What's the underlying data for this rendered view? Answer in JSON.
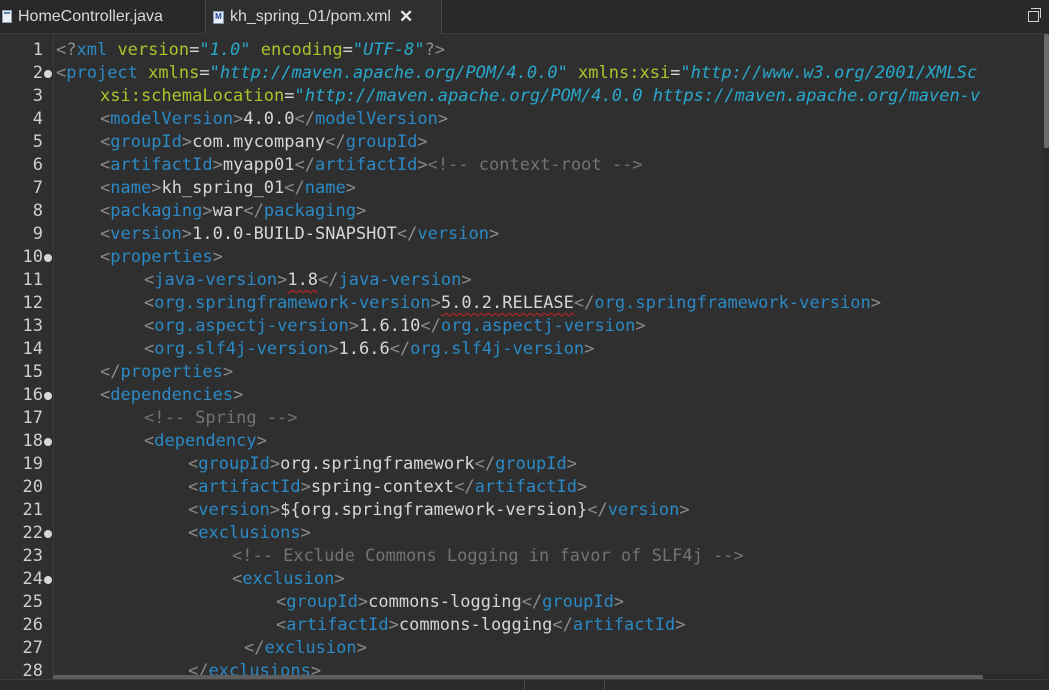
{
  "tabs": [
    {
      "label": "HomeController.java",
      "icon": "java-file-icon",
      "active": false
    },
    {
      "label": "kh_spring_01/pom.xml",
      "icon": "maven-pom-icon",
      "active": true,
      "close": "✕"
    }
  ],
  "editor": {
    "line_numbers": [
      "1",
      "2",
      "3",
      "4",
      "5",
      "6",
      "7",
      "8",
      "9",
      "10",
      "11",
      "12",
      "13",
      "14",
      "15",
      "16",
      "17",
      "18",
      "19",
      "20",
      "21",
      "22",
      "23",
      "24",
      "25",
      "26",
      "27",
      "28"
    ],
    "folded_lines": [
      "2",
      "10",
      "16",
      "18",
      "22",
      "24"
    ],
    "lines": {
      "l1": {
        "pi_open": "<?",
        "tag": "xml",
        "a1": " version",
        "eq1": "=",
        "v1": "\"1.0\"",
        "a2": " encoding",
        "eq2": "=",
        "v2": "\"UTF-8\"",
        "pi_close": "?>"
      },
      "l2": {
        "open": "<",
        "tag": "project",
        "a1": " xmlns",
        "eq1": "=",
        "v1": "\"http://maven.apache.org/POM/4.0.0\"",
        "a2": " xmlns:xsi",
        "eq2": "=",
        "v2": "\"http://www.w3.org/2001/XMLSc"
      },
      "l3": {
        "a1": "xsi:schemaLocation",
        "eq1": "=",
        "v1": "\"http://maven.apache.org/POM/4.0.0 https://maven.apache.org/maven-v"
      },
      "l4": {
        "tag": "modelVersion",
        "text": "4.0.0"
      },
      "l5": {
        "tag": "groupId",
        "text": "com.mycompany"
      },
      "l6": {
        "tag": "artifactId",
        "text": "myapp01",
        "comment": "<!-- context-root -->"
      },
      "l7": {
        "tag": "name",
        "text": "kh_spring_01"
      },
      "l8": {
        "tag": "packaging",
        "text": "war"
      },
      "l9": {
        "tag": "version",
        "text": "1.0.0-BUILD-SNAPSHOT"
      },
      "l10": {
        "tag": "properties"
      },
      "l11": {
        "tag": "java-version",
        "text": "1.8"
      },
      "l12": {
        "tag": "org.springframework-version",
        "text": "5.0.2.RELEASE"
      },
      "l13": {
        "tag": "org.aspectj-version",
        "text": "1.6.10"
      },
      "l14": {
        "tag": "org.slf4j-version",
        "text": "1.6.6"
      },
      "l15": {
        "tag": "properties"
      },
      "l16": {
        "tag": "dependencies"
      },
      "l17": {
        "comment": "<!-- Spring -->"
      },
      "l18": {
        "tag": "dependency"
      },
      "l19": {
        "tag": "groupId",
        "text": "org.springframework"
      },
      "l20": {
        "tag": "artifactId",
        "text": "spring-context"
      },
      "l21": {
        "tag": "version",
        "text": "${org.springframework-version}"
      },
      "l22": {
        "tag": "exclusions"
      },
      "l23": {
        "comment": "<!-- Exclude Commons Logging in favor of SLF4j -->"
      },
      "l24": {
        "tag": "exclusion"
      },
      "l25": {
        "tag": "groupId",
        "text": "commons-logging"
      },
      "l26": {
        "tag": "artifactId",
        "text": "commons-logging"
      },
      "l27": {
        "tag": "exclusion"
      },
      "l28": {
        "tag": "exclusions"
      }
    }
  },
  "colors": {
    "background": "#2f2f2f",
    "tag": "#2b8ac6",
    "attribute": "#a7c62b",
    "attribute_value": "#2aa8cc",
    "comment": "#737373",
    "text": "#d6d6d6",
    "error_underline": "#d02020"
  }
}
